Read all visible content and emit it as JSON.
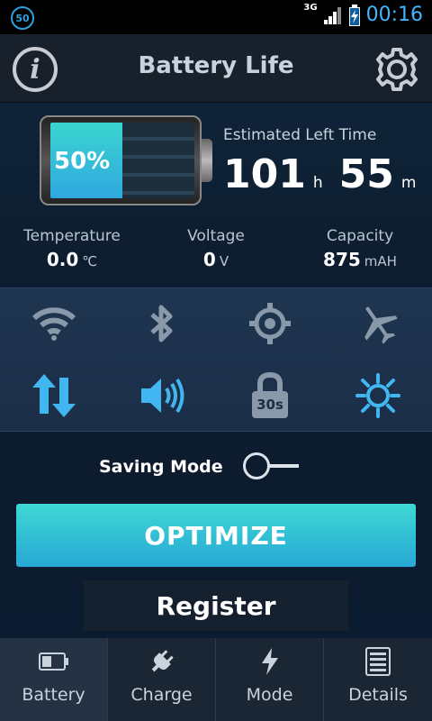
{
  "status_bar": {
    "notification_count": "50",
    "network": "3G",
    "time": "00:16"
  },
  "header": {
    "title": "Battery Life",
    "left_icon": "info-icon",
    "right_icon": "gear-icon"
  },
  "battery": {
    "percent_label": "50%",
    "level": 0.5,
    "estimated_label": "Estimated Left Time",
    "hours": "101",
    "hours_unit": "h",
    "minutes": "55",
    "minutes_unit": "m"
  },
  "stats": [
    {
      "label": "Temperature",
      "value": "0.0",
      "unit": "℃"
    },
    {
      "label": "Voltage",
      "value": "0",
      "unit": "V"
    },
    {
      "label": "Capacity",
      "value": "875",
      "unit": "mAH"
    }
  ],
  "toggles": [
    {
      "icon": "wifi-icon"
    },
    {
      "icon": "bluetooth-icon"
    },
    {
      "icon": "gps-icon"
    },
    {
      "icon": "airplane-icon"
    },
    {
      "icon": "data-sync-icon"
    },
    {
      "icon": "volume-icon"
    },
    {
      "icon": "screen-timeout-lock-icon",
      "text": "30s"
    },
    {
      "icon": "brightness-icon"
    }
  ],
  "saving_mode": {
    "label": "Saving Mode",
    "enabled": false
  },
  "buttons": {
    "optimize": "OPTIMIZE",
    "register": "Register"
  },
  "nav": [
    {
      "label": "Battery",
      "icon": "battery-icon"
    },
    {
      "label": "Charge",
      "icon": "plug-icon"
    },
    {
      "label": "Mode",
      "icon": "lightning-icon"
    },
    {
      "label": "Details",
      "icon": "details-icon"
    }
  ],
  "colors": {
    "accent": "#3ad5cf",
    "toggle_active": "#42b6f0",
    "toggle_inactive": "#8a99aa"
  }
}
